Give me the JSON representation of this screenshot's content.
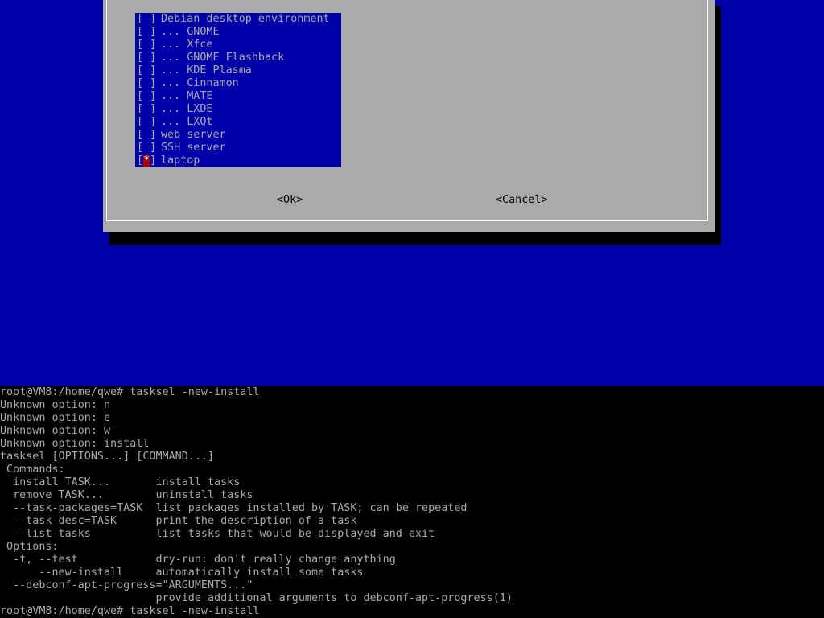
{
  "dialog": {
    "tasks": [
      {
        "mark": " ",
        "label": "Debian desktop environment"
      },
      {
        "mark": " ",
        "label": "... GNOME"
      },
      {
        "mark": " ",
        "label": "... Xfce"
      },
      {
        "mark": " ",
        "label": "... GNOME Flashback"
      },
      {
        "mark": " ",
        "label": "... KDE Plasma"
      },
      {
        "mark": " ",
        "label": "... Cinnamon"
      },
      {
        "mark": " ",
        "label": "... MATE"
      },
      {
        "mark": " ",
        "label": "... LXDE"
      },
      {
        "mark": " ",
        "label": "... LXQt"
      },
      {
        "mark": " ",
        "label": "web server"
      },
      {
        "mark": " ",
        "label": "SSH server"
      },
      {
        "mark": "*",
        "label": "laptop"
      }
    ],
    "ok_label": "<Ok>",
    "cancel_label": "<Cancel>"
  },
  "terminal": {
    "lines": [
      "root@VM8:/home/qwe# tasksel -new-install",
      "Unknown option: n",
      "Unknown option: e",
      "Unknown option: w",
      "Unknown option: install",
      "tasksel [OPTIONS...] [COMMAND...]",
      " Commands:",
      "  install TASK...       install tasks",
      "  remove TASK...        uninstall tasks",
      "  --task-packages=TASK  list packages installed by TASK; can be repeated",
      "  --task-desc=TASK      print the description of a task",
      "  --list-tasks          list tasks that would be displayed and exit",
      " Options:",
      "  -t, --test            dry-run: don't really change anything",
      "      --new-install     automatically install some tasks",
      "  --debconf-apt-progress=\"ARGUMENTS...\"",
      "                        provide additional arguments to debconf-apt-progress(1)",
      "root@VM8:/home/qwe# tasksel -new-install"
    ]
  },
  "colors": {
    "tui_background": "#0000aa",
    "dialog_background": "#aaaaaa",
    "cursor_highlight": "#aa0000",
    "terminal_background": "#000000",
    "terminal_text": "#aaaaaa"
  }
}
